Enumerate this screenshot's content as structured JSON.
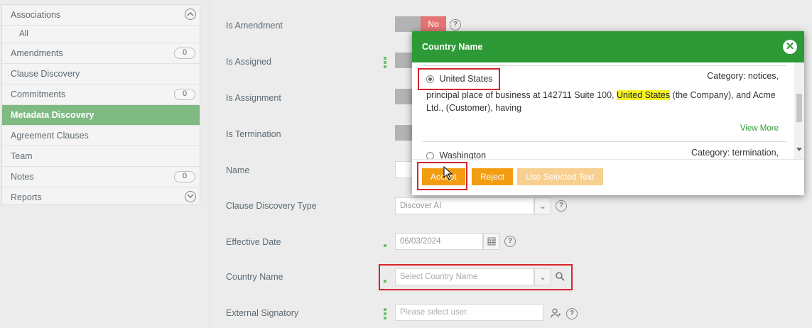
{
  "sidebar": {
    "items": [
      {
        "label": "Associations"
      },
      {
        "label": "All"
      },
      {
        "label": "Amendments",
        "count": "0"
      },
      {
        "label": "Clause Discovery"
      },
      {
        "label": "Commitments",
        "count": "0"
      },
      {
        "label": "Metadata Discovery",
        "active": true
      },
      {
        "label": "Agreement Clauses"
      },
      {
        "label": "Team"
      },
      {
        "label": "Notes",
        "count": "0"
      },
      {
        "label": "Reports"
      }
    ]
  },
  "form": {
    "is_amendment": {
      "label": "Is Amendment",
      "value": "No"
    },
    "is_assigned": {
      "label": "Is Assigned"
    },
    "is_assignment": {
      "label": "Is Assignment"
    },
    "is_termination": {
      "label": "Is Termination"
    },
    "name": {
      "label": "Name"
    },
    "clause_discovery_type": {
      "label": "Clause Discovery Type",
      "value": "Discover AI"
    },
    "effective_date": {
      "label": "Effective Date",
      "value": "06/03/2024"
    },
    "country_name": {
      "label": "Country Name",
      "placeholder": "Select Country Name"
    },
    "external_signatory": {
      "label": "External Signatory",
      "placeholder": "Please select user."
    }
  },
  "modal": {
    "title": "Country Name",
    "results": [
      {
        "name": "United States",
        "category": "Category: notices,",
        "text_before": "principal place of business at 142711 Suite 100, ",
        "highlight": "United States",
        "text_after": " (the Company), and Acme Ltd., (Customer), having",
        "view_more": "View More",
        "selected": true
      },
      {
        "name": "Washington",
        "category": "Category: termination,",
        "selected": false
      }
    ],
    "buttons": {
      "accept": "Accept",
      "reject": "Reject",
      "use_selected": "Use Selected Text"
    }
  },
  "colors": {
    "accent_green": "#2e9a37",
    "sidebar_active": "#7fba83",
    "button_orange": "#f39c12",
    "highlight_red": "#d8232a",
    "toggle_no": "#e57373"
  }
}
